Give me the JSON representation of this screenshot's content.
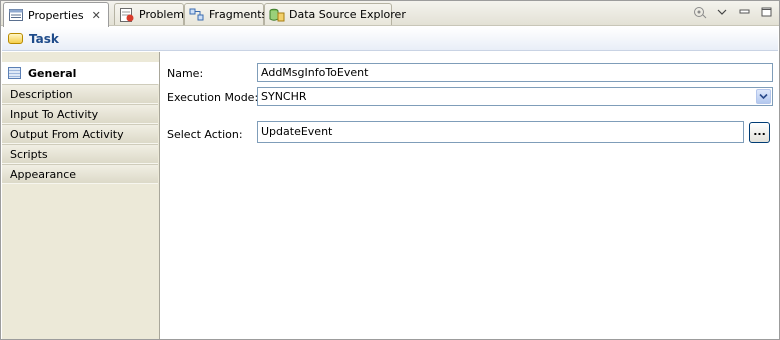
{
  "tabs": [
    {
      "label": "Properties",
      "icon": "properties-icon",
      "active": true,
      "close": "✕"
    },
    {
      "label": "Problems",
      "icon": "problems-icon",
      "active": false
    },
    {
      "label": "Fragments",
      "icon": "fragments-icon",
      "active": false
    },
    {
      "label": "Data Source Explorer",
      "icon": "data-source-explorer-icon",
      "active": false
    }
  ],
  "toolbar": {
    "tools": [
      "pin-view-icon",
      "view-menu-icon",
      "minimize-icon",
      "maximize-icon"
    ]
  },
  "header": {
    "title": "Task"
  },
  "sidebar": {
    "items": [
      {
        "label": "General",
        "active": true
      },
      {
        "label": "Description"
      },
      {
        "label": "Input To Activity"
      },
      {
        "label": "Output From Activity"
      },
      {
        "label": "Scripts"
      },
      {
        "label": "Appearance"
      }
    ]
  },
  "form": {
    "name_label": "Name:",
    "name_value": "AddMsgInfoToEvent",
    "mode_label": "Execution Mode:",
    "mode_value": "SYNCHR",
    "action_label": "Select Action:",
    "action_value": "UpdateEvent",
    "browse_label": "..."
  },
  "colors": {
    "title_text": "#1e4b8a",
    "field_border": "#7f9db9",
    "sidebar_bg": "#ece9d8"
  }
}
